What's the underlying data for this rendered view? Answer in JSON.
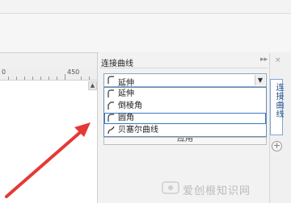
{
  "canvas": {
    "ruler_labels": [
      "0",
      "450"
    ]
  },
  "docker": {
    "title": "连接曲线",
    "controls": [
      "▸▸",
      "×"
    ],
    "dropdown": {
      "value": "延伸",
      "icon": "extend-connector-icon",
      "arrow_icon": "chevron-down-icon"
    },
    "options": [
      {
        "label": "延伸",
        "icon": "extend-connector-icon"
      },
      {
        "label": "倒棱角",
        "icon": "chamfer-corner-icon"
      },
      {
        "label": "圆角",
        "icon": "round-corner-icon",
        "selected": true
      },
      {
        "label": "贝塞尔曲线",
        "icon": "bezier-curve-icon"
      }
    ],
    "apply_label": "应用"
  },
  "side_tabs": {
    "active_tab": "连接曲线",
    "add_icon": "plus-icon"
  },
  "annotation": {
    "arrow_color": "#e53935"
  },
  "watermark": {
    "text": "爱创根知识网"
  },
  "colors": {
    "selection_border": "#3a78c6",
    "tab_text": "#1f4f86"
  }
}
